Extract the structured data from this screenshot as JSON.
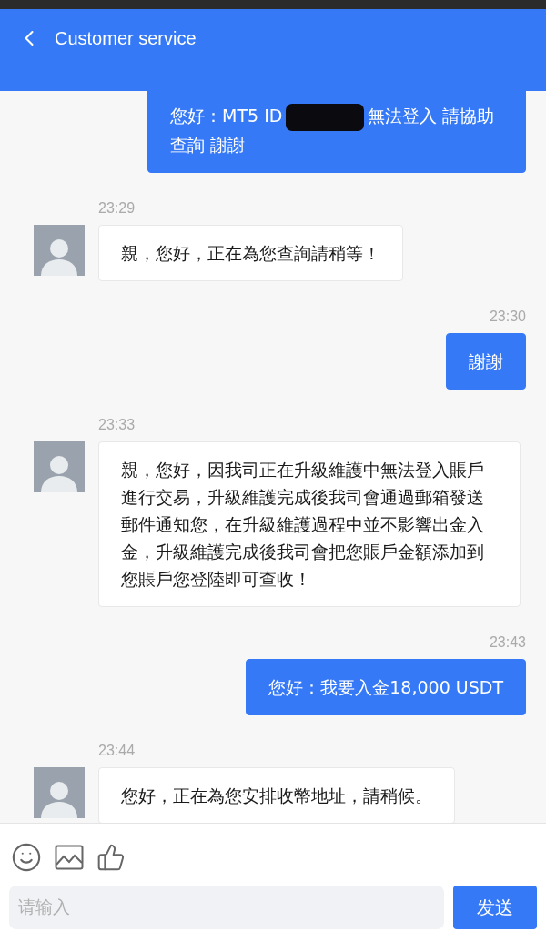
{
  "header": {
    "title": "Customer service"
  },
  "messages": [
    {
      "kind": "outgoing",
      "parts": [
        {
          "kind": "text",
          "text": "您好：MT5 ID"
        },
        {
          "kind": "redaction"
        },
        {
          "kind": "text",
          "text": "無法登入 請協助查詢 謝謝"
        }
      ]
    },
    {
      "kind": "incoming",
      "time": "23:29",
      "parts": [
        {
          "kind": "text",
          "text": "親，您好，正在為您查詢請稍等！"
        }
      ]
    },
    {
      "kind": "outgoing",
      "time": "23:30",
      "parts": [
        {
          "kind": "text",
          "text": "謝謝"
        }
      ]
    },
    {
      "kind": "incoming",
      "time": "23:33",
      "parts": [
        {
          "kind": "text",
          "text": "親，您好，因我司正在升級維護中無法登入賬戶進行交易，升級維護完成後我司會通過郵箱發送郵件通知您，在升級維護過程中並不影響出金入金，升級維護完成後我司會把您賬戶金額添加到您賬戶您登陸即可查收！"
        }
      ]
    },
    {
      "kind": "outgoing",
      "time": "23:43",
      "parts": [
        {
          "kind": "text",
          "text": "您好：我要入金18,000 USDT"
        }
      ]
    },
    {
      "kind": "incoming",
      "time": "23:44",
      "parts": [
        {
          "kind": "text",
          "text": "您好，正在為您安排收幣地址，請稍候。"
        }
      ]
    }
  ],
  "composer": {
    "placeholder": "请输入",
    "send_label": "发送"
  }
}
